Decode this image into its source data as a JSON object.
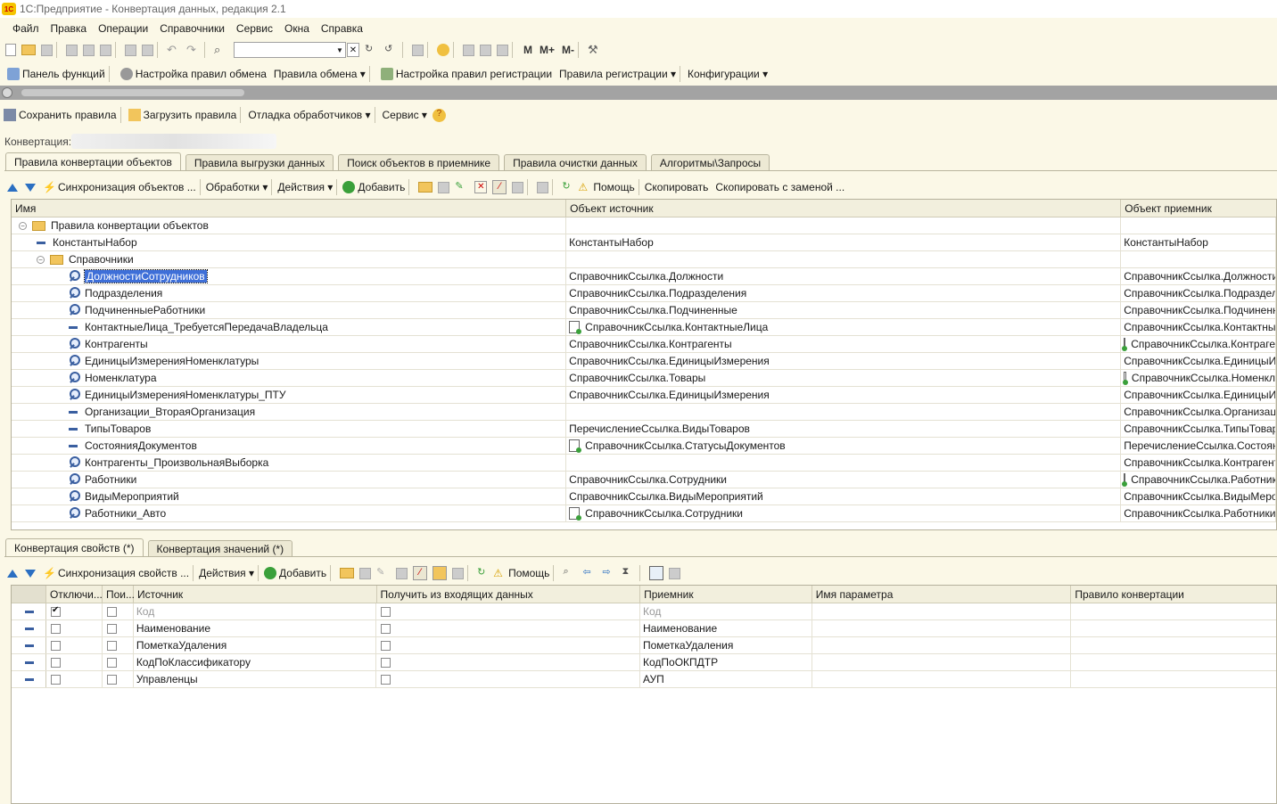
{
  "window": {
    "title": "1С:Предприятие - Конвертация данных, редакция 2.1",
    "logo_text": "1С"
  },
  "menu": [
    "Файл",
    "Правка",
    "Операции",
    "Справочники",
    "Сервис",
    "Окна",
    "Справка"
  ],
  "toolbar_main": {
    "m_labels": [
      "M",
      "M+",
      "M-"
    ]
  },
  "toolbar_functions": {
    "items": [
      "Панель функций",
      "Настройка правил обмена",
      "Правила обмена ▾",
      "Настройка правил регистрации",
      "Правила регистрации ▾",
      "Конфигурации ▾"
    ]
  },
  "form_toolbar": {
    "items": [
      "Сохранить правила",
      "Загрузить правила",
      "Отладка обработчиков ▾",
      "Сервис ▾"
    ]
  },
  "conversion": {
    "label": "Конвертация:"
  },
  "top_tabs": [
    "Правила конвертации объектов",
    "Правила выгрузки данных",
    "Поиск объектов в приемнике",
    "Правила очистки данных",
    "Алгоритмы\\Запросы"
  ],
  "rules_toolbar": {
    "sync": "Синхронизация объектов ...",
    "processing": "Обработки ▾",
    "actions": "Действия ▾",
    "add": "Добавить",
    "help": "Помощь",
    "copy": "Скопировать",
    "copy_replace": "Скопировать с заменой ..."
  },
  "rules_grid": {
    "columns": [
      "Имя",
      "Объект источник",
      "Объект приемник"
    ],
    "rows": [
      {
        "level": 0,
        "kind": "folder-open",
        "name": "Правила конвертации объектов",
        "src": "",
        "dst": ""
      },
      {
        "level": 1,
        "kind": "dash",
        "name": "КонстантыНабор",
        "src": "КонстантыНабор",
        "dst": "КонстантыНабор"
      },
      {
        "level": 1,
        "kind": "folder-open",
        "name": "Справочники",
        "src": "",
        "dst": ""
      },
      {
        "level": 2,
        "kind": "mag",
        "name": "ДолжностиСотрудников",
        "src": "СправочникСсылка.Должности",
        "dst": "СправочникСсылка.ДолжностиСо",
        "selected": true
      },
      {
        "level": 2,
        "kind": "mag",
        "name": "Подразделения",
        "src": "СправочникСсылка.Подразделения",
        "dst": "СправочникСсылка.Подразделен"
      },
      {
        "level": 2,
        "kind": "mag",
        "name": "ПодчиненныеРаботники",
        "src": "СправочникСсылка.Подчиненные",
        "dst": "СправочникСсылка.Подчиненные"
      },
      {
        "level": 2,
        "kind": "dash",
        "name": "КонтактныеЛица_ТребуетсяПередачаВладельца",
        "src": "СправочникСсылка.КонтактныеЛица",
        "src_icon": true,
        "dst": "СправочникСсылка.КонтактныеЛ"
      },
      {
        "level": 2,
        "kind": "mag",
        "name": "Контрагенты",
        "src": "СправочникСсылка.Контрагенты",
        "dst": "СправочникСсылка.Контраге",
        "dst_icon": true
      },
      {
        "level": 2,
        "kind": "mag",
        "name": "ЕдиницыИзмеренияНоменклатуры",
        "src": "СправочникСсылка.ЕдиницыИзмерения",
        "dst": "СправочникСсылка.ЕдиницыИзм"
      },
      {
        "level": 2,
        "kind": "mag",
        "name": "Номенклатура",
        "src": "СправочникСсылка.Товары",
        "dst": "СправочникСсылка.Номенкл",
        "dst_icon": true
      },
      {
        "level": 2,
        "kind": "mag",
        "name": "ЕдиницыИзмеренияНоменклатуры_ПТУ",
        "src": "СправочникСсылка.ЕдиницыИзмерения",
        "dst": "СправочникСсылка.ЕдиницыИзм"
      },
      {
        "level": 2,
        "kind": "dash",
        "name": "Организации_ВтораяОрганизация",
        "src": "",
        "dst": "СправочникСсылка.Организации"
      },
      {
        "level": 2,
        "kind": "dash",
        "name": "ТипыТоваров",
        "src": "ПеречислениеСсылка.ВидыТоваров",
        "dst": "СправочникСсылка.ТипыТоваров"
      },
      {
        "level": 2,
        "kind": "dash",
        "name": "СостоянияДокументов",
        "src": "СправочникСсылка.СтатусыДокументов",
        "src_icon": true,
        "dst": "ПеречислениеСсылка.Состояния"
      },
      {
        "level": 2,
        "kind": "mag",
        "name": "Контрагенты_ПроизвольнаяВыборка",
        "src": "",
        "dst": "СправочникСсылка.Контрагенты"
      },
      {
        "level": 2,
        "kind": "mag",
        "name": "Работники",
        "src": "СправочникСсылка.Сотрудники",
        "dst": "СправочникСсылка.Работник",
        "dst_icon": true
      },
      {
        "level": 2,
        "kind": "mag",
        "name": "ВидыМероприятий",
        "src": "СправочникСсылка.ВидыМероприятий",
        "dst": "СправочникСсылка.ВидыМеропри"
      },
      {
        "level": 2,
        "kind": "mag",
        "name": "Работники_Авто",
        "src": "СправочникСсылка.Сотрудники",
        "src_icon": true,
        "dst": "СправочникСсылка.Работники"
      }
    ]
  },
  "bottom_tabs": [
    "Конвертация свойств (*)",
    "Конвертация значений (*)"
  ],
  "props_toolbar": {
    "sync": "Синхронизация свойств ...",
    "actions": "Действия ▾",
    "add": "Добавить",
    "help": "Помощь"
  },
  "props_grid": {
    "columns": [
      "",
      "Отключи...",
      "Пои...",
      "Источник",
      "Получить из входящих данных",
      "Приемник",
      "Имя параметра",
      "Правило конвертации"
    ],
    "rows": [
      {
        "off": true,
        "search": false,
        "src": "Код",
        "incoming": false,
        "dst": "Код",
        "grey": true
      },
      {
        "off": false,
        "search": false,
        "src": "Наименование",
        "incoming": false,
        "dst": "Наименование"
      },
      {
        "off": false,
        "search": false,
        "src": "ПометкаУдаления",
        "incoming": false,
        "dst": "ПометкаУдаления"
      },
      {
        "off": false,
        "search": false,
        "src": "КодПоКлассификатору",
        "incoming": false,
        "dst": "КодПоОКПДТР"
      },
      {
        "off": false,
        "search": false,
        "src": "Управленцы",
        "incoming": false,
        "dst": "АУП"
      }
    ]
  }
}
